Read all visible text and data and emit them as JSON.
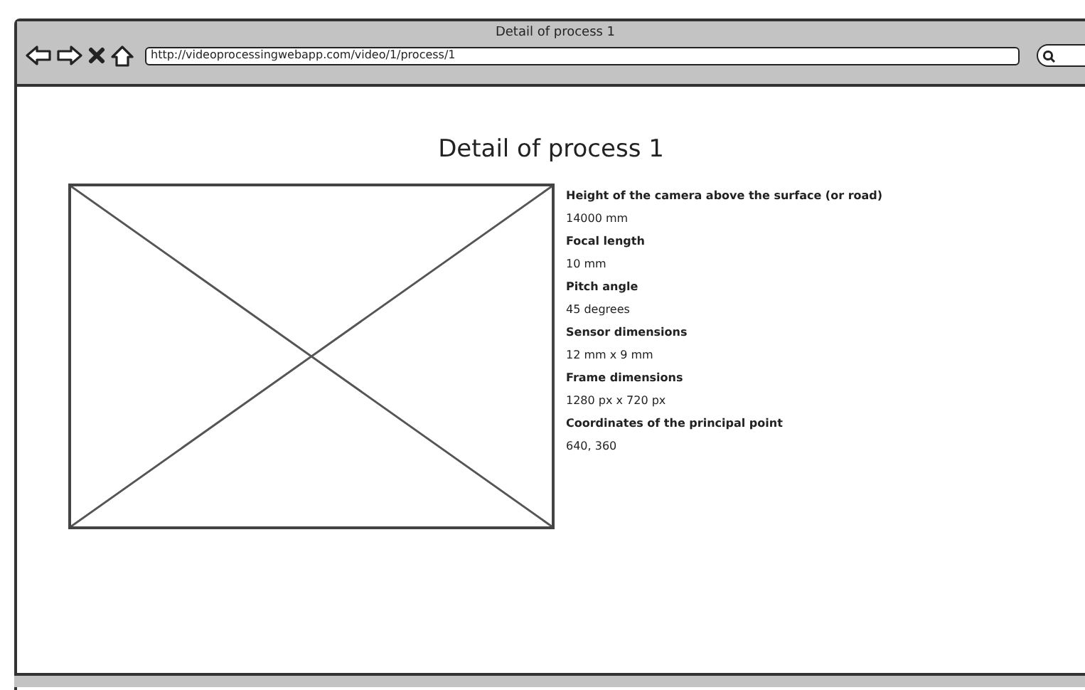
{
  "window": {
    "title": "Detail of process 1",
    "address": "http://videoprocessingwebapp.com/video/1/process/1"
  },
  "page": {
    "heading": "Detail of process 1"
  },
  "details": [
    {
      "label": "Height of the camera above the surface (or road)",
      "value": "14000 mm"
    },
    {
      "label": "Focal length",
      "value": "10 mm"
    },
    {
      "label": "Pitch angle",
      "value": "45 degrees"
    },
    {
      "label": "Sensor dimensions",
      "value": "12 mm x 9 mm"
    },
    {
      "label": "Frame dimensions",
      "value": "1280 px x 720 px"
    },
    {
      "label": "Coordinates of the principal point",
      "value": "640, 360"
    }
  ]
}
